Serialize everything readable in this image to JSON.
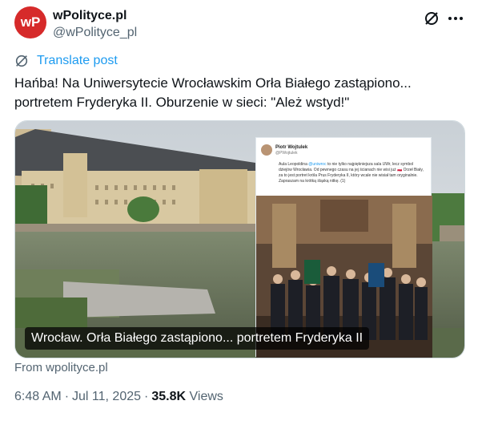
{
  "account": {
    "display_name": "wPolityce.pl",
    "handle": "@wPolityce_pl",
    "avatar_text": "wP"
  },
  "translate_label": "Translate post",
  "post_text": [
    "Hańba! Na Uniwersytecie Wrocławskim Orła Białego zastąpiono...",
    "portretem Fryderyka II. Oburzenie w sieci: \"Ależ wstyd!\""
  ],
  "card": {
    "caption": "Wrocław. Orła Białego zastąpiono... portretem Fryderyka II",
    "embedded_post": {
      "author": "Piotr Wojtulek",
      "handle": "@PWojtulek",
      "text_before_mention": "Aula Leopoldina ",
      "mention": "@uniwroc",
      "text_after_mention": " to nie tylko najpiękniejsza sala UWr, lecz symbol dziejów Wrocławia. Od pewnego czasu na jej ścianach nie wisi już 🇵🇱 Orzeł Biały, za to jest portret króla Prus Fryderyka II, który wcale nie wisiał tam oryginalnie. Zapraszam na krótką śląską nitkę. (1)"
    },
    "source": "From wpolityce.pl"
  },
  "meta": {
    "time": "6:48 AM",
    "date": "Jul 11, 2025",
    "views_count": "35.8K",
    "views_label": "Views",
    "separator": "·"
  },
  "colors": {
    "link": "#1d9bf0",
    "secondary_text": "#536471",
    "avatar_bg": "#d62a2a"
  },
  "icons": [
    "grok-icon",
    "more-icon",
    "translate-icon"
  ]
}
